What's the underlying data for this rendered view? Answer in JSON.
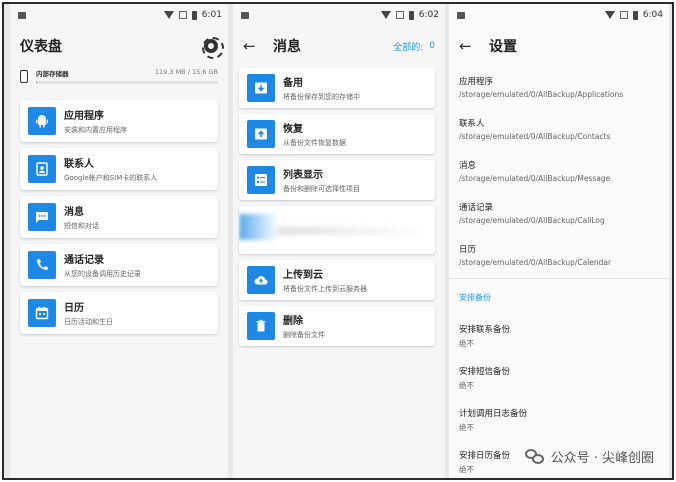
{
  "screens": [
    {
      "status_time": "6:01",
      "title": "仪表盘",
      "storage": {
        "label": "内部存储器",
        "size": "119.3 MB / 15.6 GB",
        "used_fraction": 0.0076
      },
      "cards": [
        {
          "icon": "android-icon",
          "title": "应用程序",
          "subtitle": "安装和内置应用程序"
        },
        {
          "icon": "contacts-icon",
          "title": "联系人",
          "subtitle": "Google帐户和SIM卡的联系人"
        },
        {
          "icon": "message-icon",
          "title": "消息",
          "subtitle": "短信和对话"
        },
        {
          "icon": "phone-icon",
          "title": "通话记录",
          "subtitle": "从您的设备调用历史记录"
        },
        {
          "icon": "calendar-icon",
          "title": "日历",
          "subtitle": "日历活动和生日"
        }
      ]
    },
    {
      "status_time": "6:02",
      "title": "消息",
      "select_all_label": "全部的:",
      "select_count": "0",
      "cards": [
        {
          "icon": "backup-icon",
          "title": "备用",
          "subtitle": "将备份保存到您的存储中"
        },
        {
          "icon": "restore-icon",
          "title": "恢复",
          "subtitle": "从备份文件恢复数据"
        },
        {
          "icon": "list-icon",
          "title": "列表显示",
          "subtitle": "备份和删除可选择性项目"
        },
        {
          "icon": "cloud-upload-icon",
          "title": "上传到云",
          "subtitle": "将备份文件上传到云服务器"
        },
        {
          "icon": "delete-icon",
          "title": "删除",
          "subtitle": "删除备份文件"
        }
      ]
    },
    {
      "status_time": "6:04",
      "title": "设置",
      "paths": [
        {
          "label": "应用程序",
          "path": "/storage/emulated/0/AllBackup/Applications"
        },
        {
          "label": "联系人",
          "path": "/storage/emulated/0/AllBackup/Contacts"
        },
        {
          "label": "消息",
          "path": "/storage/emulated/0/AllBackup/Message"
        },
        {
          "label": "通话记录",
          "path": "/storage/emulated/0/AllBackup/CallLog"
        },
        {
          "label": "日历",
          "path": "/storage/emulated/0/AllBackup/Calendar"
        }
      ],
      "schedule_header": "安排备份",
      "schedules": [
        {
          "label": "安排联系备份",
          "value": "绝不"
        },
        {
          "label": "安排短信备份",
          "value": "绝不"
        },
        {
          "label": "计划调用日志备份",
          "value": "绝不"
        },
        {
          "label": "安排日历备份",
          "value": "绝不"
        }
      ]
    }
  ],
  "watermark": "公众号 · 尖峰创圈",
  "colors": {
    "accent": "#1e88e5",
    "link": "#2196f3"
  }
}
